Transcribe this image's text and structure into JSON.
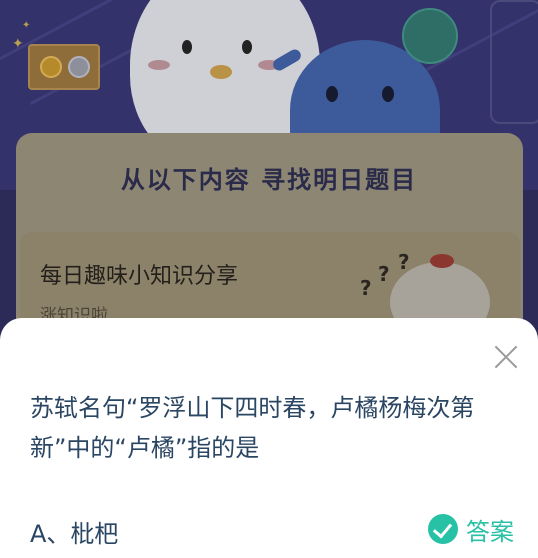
{
  "background": {
    "card_title": "从以下内容  寻找明日题目",
    "share_title": "每日趣味小知识分享",
    "share_sub": "涨知识啦",
    "question_marks": [
      "?",
      "?",
      "?"
    ]
  },
  "sheet": {
    "question": "苏轼名句“罗浮山下四时春，卢橘杨梅次第新”中的“卢橘”指的是",
    "option_a": "A、枇杷",
    "answer_label": "答案"
  },
  "colors": {
    "accent": "#27c2a6",
    "question_text": "#2b4663"
  },
  "icons": {
    "close": "close-icon",
    "check": "check-circle-icon"
  }
}
